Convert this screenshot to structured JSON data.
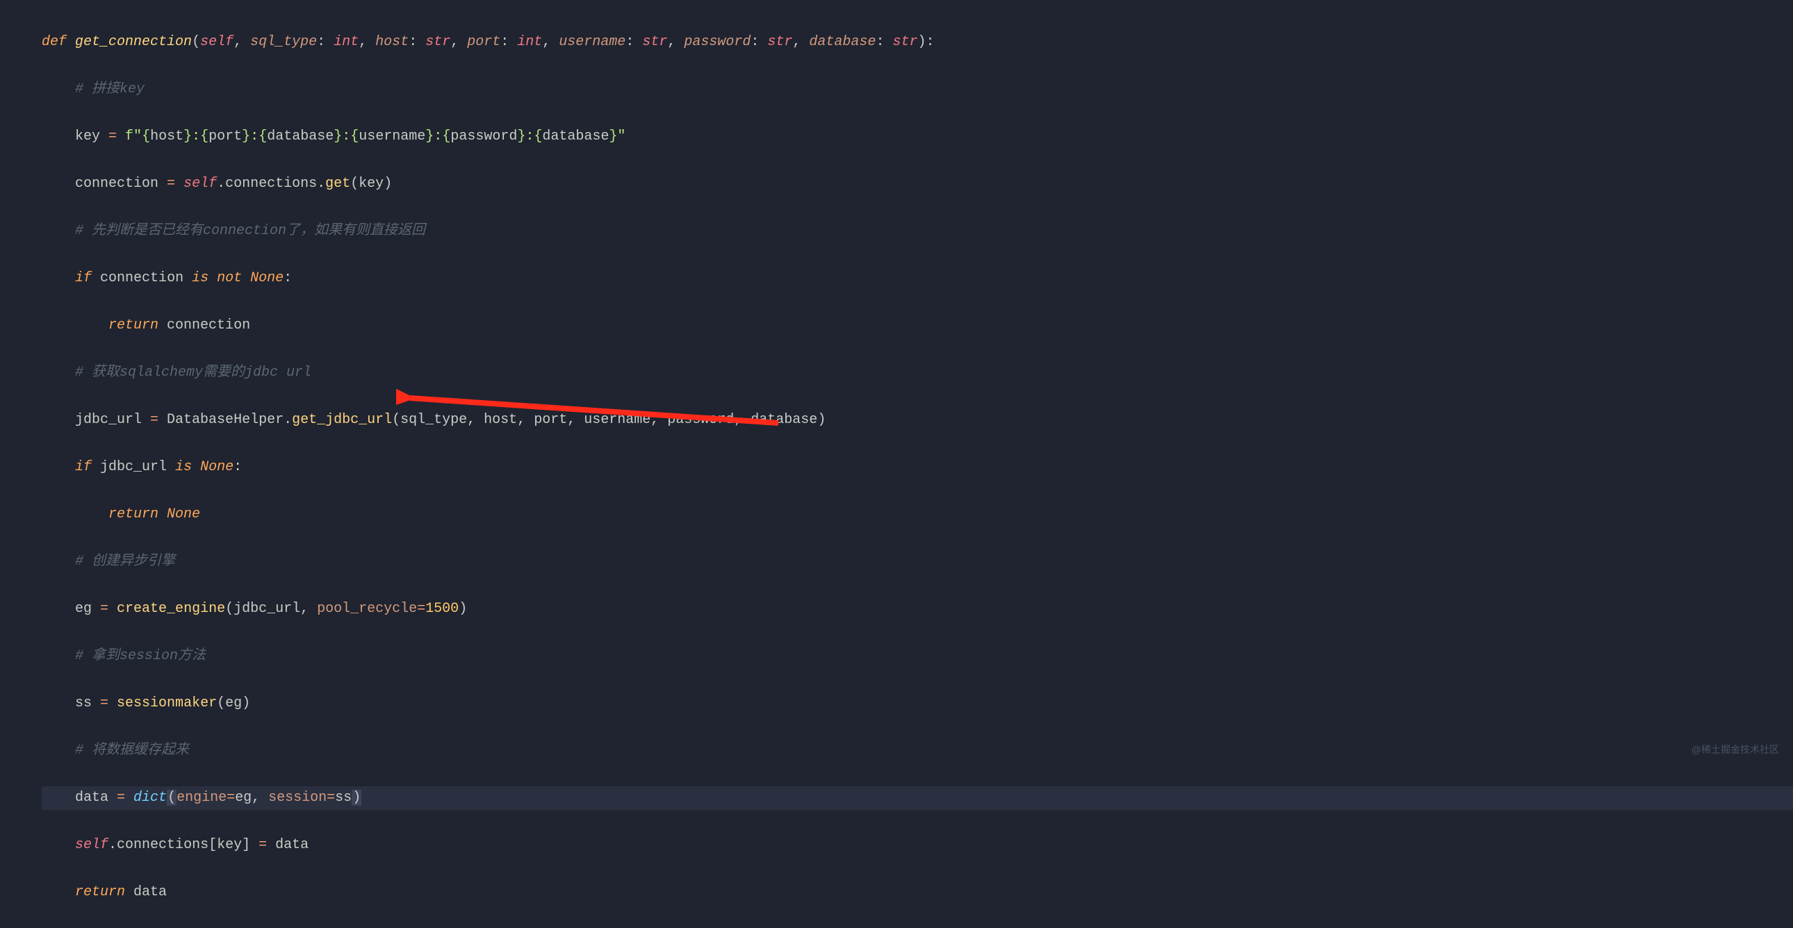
{
  "code": {
    "line1": {
      "def": "def",
      "fn": "get_connection",
      "lp": "(",
      "self": "self",
      "c1": ", ",
      "p_sqltype": "sql_type",
      "col1": ": ",
      "t_int1": "int",
      "c2": ", ",
      "p_host": "host",
      "col2": ": ",
      "t_str1": "str",
      "c3": ", ",
      "p_port": "port",
      "col3": ": ",
      "t_int2": "int",
      "c4": ", ",
      "p_username": "username",
      "col4": ": ",
      "t_str2": "str",
      "c5": ", ",
      "p_password": "password",
      "col5": ": ",
      "t_str3": "str",
      "c6": ", ",
      "p_database": "database",
      "col6": ": ",
      "t_str4": "str",
      "rp": ")",
      "end": ":"
    },
    "line2": {
      "comment": "# 拼接key"
    },
    "line3": {
      "var": "key",
      "eq": " = ",
      "fprefix": "f\"",
      "lb1": "{",
      "v1": "host",
      "rb1": "}",
      "sep1": ":",
      "lb2": "{",
      "v2": "port",
      "rb2": "}",
      "sep2": ":",
      "lb3": "{",
      "v3": "database",
      "rb3": "}",
      "sep3": ":",
      "lb4": "{",
      "v4": "username",
      "rb4": "}",
      "sep4": ":",
      "lb5": "{",
      "v5": "password",
      "rb5": "}",
      "sep5": ":",
      "lb6": "{",
      "v6": "database",
      "rb6": "}",
      "endquote": "\""
    },
    "line4": {
      "var": "connection",
      "eq": " = ",
      "self": "self",
      "dot1": ".",
      "attr": "connections",
      "dot2": ".",
      "method": "get",
      "lp": "(",
      "arg": "key",
      "rp": ")"
    },
    "line5": {
      "comment": "# 先判断是否已经有connection了，如果有则直接返回"
    },
    "line6": {
      "if": "if",
      "sp1": " ",
      "var": "connection",
      "sp2": " ",
      "is": "is",
      "sp3": " ",
      "not": "not",
      "sp4": " ",
      "none": "None",
      "colon": ":"
    },
    "line7": {
      "return": "return",
      "sp": " ",
      "var": "connection"
    },
    "line8": {
      "comment": "# 获取sqlalchemy需要的jdbc url"
    },
    "line9": {
      "var": "jdbc_url",
      "eq": " = ",
      "cls": "DatabaseHelper",
      "dot": ".",
      "method": "get_jdbc_url",
      "lp": "(",
      "a1": "sql_type",
      "c1": ", ",
      "a2": "host",
      "c2": ", ",
      "a3": "port",
      "c3": ", ",
      "a4": "username",
      "c4": ", ",
      "a5": "password",
      "c5": ", ",
      "a6": "database",
      "rp": ")"
    },
    "line10": {
      "if": "if",
      "sp1": " ",
      "var": "jdbc_url",
      "sp2": " ",
      "is": "is",
      "sp3": " ",
      "none": "None",
      "colon": ":"
    },
    "line11": {
      "return": "return",
      "sp": " ",
      "none": "None"
    },
    "line12": {
      "comment": "# 创建异步引擎"
    },
    "line13": {
      "var": "eg",
      "eq": " = ",
      "fn": "create_engine",
      "lp": "(",
      "a1": "jdbc_url",
      "c1": ", ",
      "kwarg": "pool_recycle",
      "kweq": "=",
      "num": "1500",
      "rp": ")"
    },
    "line14": {
      "comment": "# 拿到session方法"
    },
    "line15": {
      "var": "ss",
      "eq": " = ",
      "fn": "sessionmaker",
      "lp": "(",
      "a1": "eg",
      "rp": ")"
    },
    "line16": {
      "comment": "# 将数据缓存起来"
    },
    "line17": {
      "var": "data",
      "eq": " = ",
      "dict": "dict",
      "lp": "(",
      "k1": "engine",
      "eq1": "=",
      "v1": "eg",
      "c1": ", ",
      "k2": "session",
      "eq2": "=",
      "v2": "ss",
      "rp": ")"
    },
    "line18": {
      "self": "self",
      "dot": ".",
      "attr": "connections",
      "lb": "[",
      "key": "key",
      "rb": "]",
      "eq": " = ",
      "val": "data"
    },
    "line19": {
      "return": "return",
      "sp": " ",
      "var": "data"
    }
  },
  "watermark": "@稀土掘金技术社区"
}
